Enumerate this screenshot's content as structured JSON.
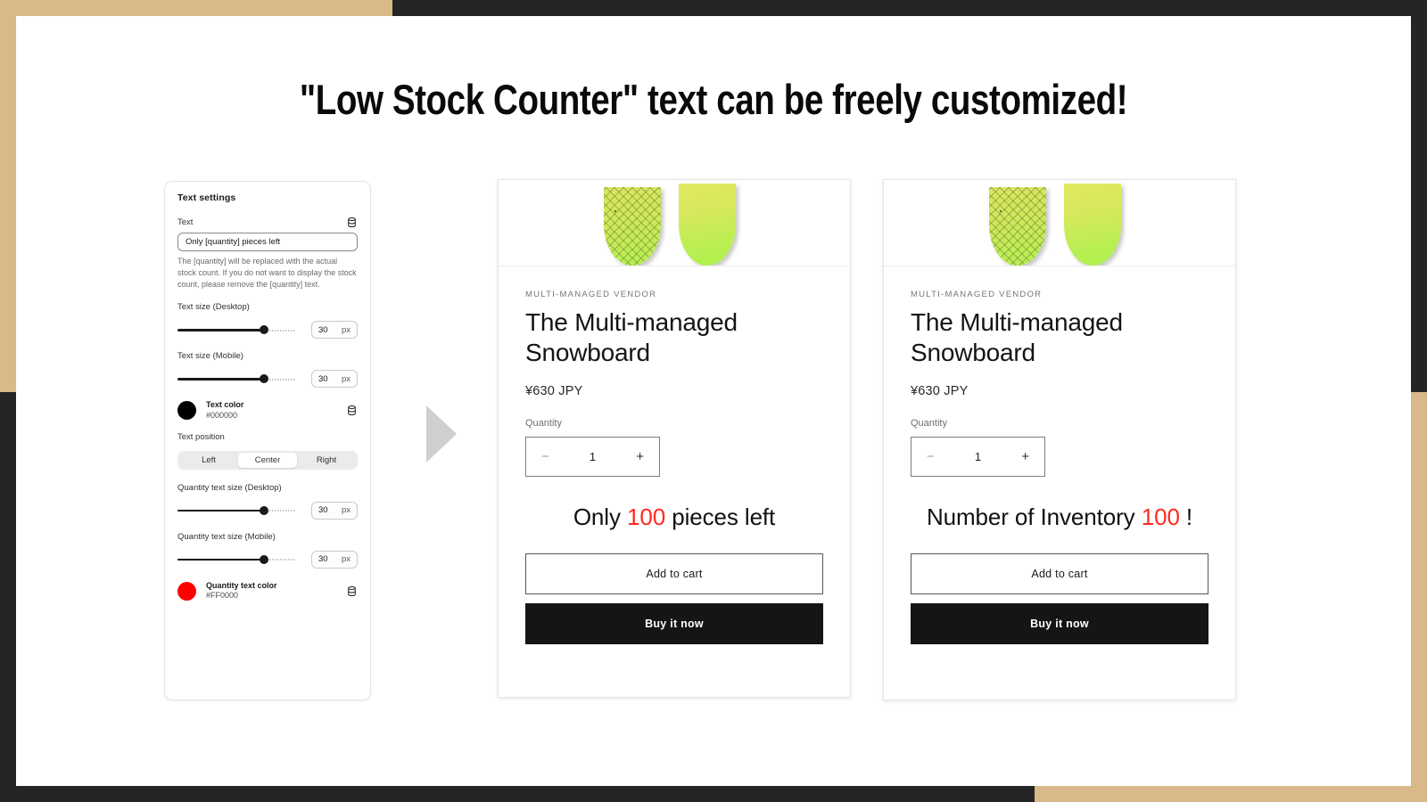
{
  "page": {
    "headline": "\"Low Stock Counter\" text can be freely customized!",
    "frame_tan_color": "#D9B889",
    "frame_dark_color": "#252525",
    "arrow_icon": "triangle-right-icon"
  },
  "settings": {
    "panel_title": "Text settings",
    "text_field": {
      "label": "Text",
      "value": "Only [quantity] pieces left",
      "icon": "database-icon"
    },
    "helper_text": "The [quantity] will be replaced with the actual stock count. If you do not want to display the stock count, please remove the [quantity] text.",
    "text_size_desktop": {
      "label": "Text size (Desktop)",
      "value": "30",
      "unit": "px",
      "percent": 73
    },
    "text_size_mobile": {
      "label": "Text size (Mobile)",
      "value": "30",
      "unit": "px",
      "percent": 73
    },
    "text_color": {
      "name": "Text color",
      "hex": "#000000",
      "icon": "database-icon"
    },
    "text_position": {
      "label": "Text position",
      "options": [
        "Left",
        "Center",
        "Right"
      ],
      "selected": "Center"
    },
    "qty_size_desktop": {
      "label": "Quantity text size (Desktop)",
      "value": "30",
      "unit": "px",
      "percent": 73
    },
    "qty_size_mobile": {
      "label": "Quantity text size (Mobile)",
      "value": "30",
      "unit": "px",
      "percent": 73
    },
    "qty_color": {
      "name": "Quantity text color",
      "hex": "#FF0000",
      "icon": "database-icon"
    }
  },
  "product_left": {
    "vendor": "MULTI-MANAGED VENDOR",
    "title": "The Multi-managed Snowboard",
    "price": "¥630 JPY",
    "quantity_label": "Quantity",
    "quantity_value": "1",
    "minus": "−",
    "plus": "+",
    "stock_prefix": "Only ",
    "stock_count": "100",
    "stock_suffix": " pieces left",
    "add_to_cart": "Add to cart",
    "buy_now": "Buy it now"
  },
  "product_right": {
    "vendor": "MULTI-MANAGED VENDOR",
    "title": "The Multi-managed Snowboard",
    "price": "¥630 JPY",
    "quantity_label": "Quantity",
    "quantity_value": "1",
    "minus": "−",
    "plus": "+",
    "stock_prefix": "Number of Inventory ",
    "stock_count": "100",
    "stock_suffix": " !",
    "add_to_cart": "Add to cart",
    "buy_now": "Buy it now"
  }
}
